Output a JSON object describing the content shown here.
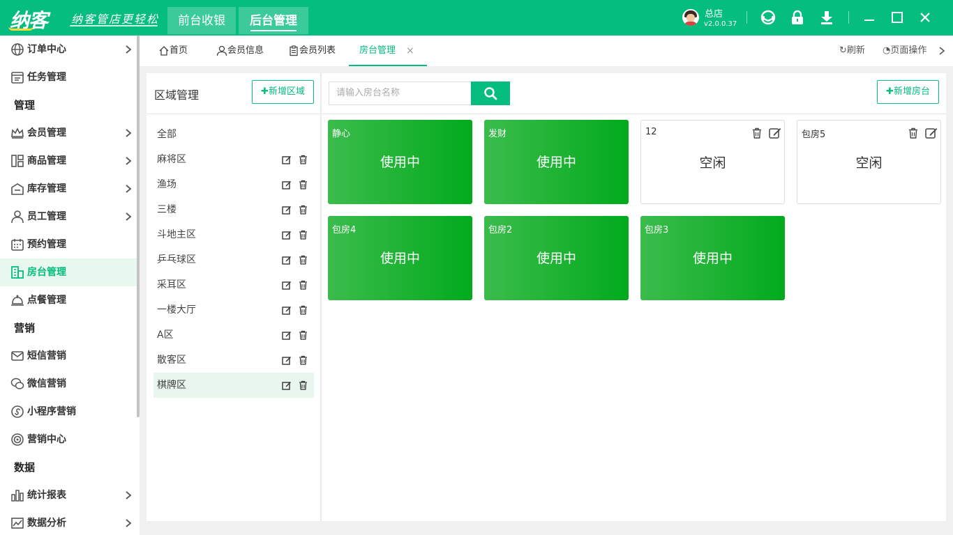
{
  "header": {
    "logo": "纳客",
    "slogan": "纳客管店更轻松",
    "nav": [
      "前台收银",
      "后台管理"
    ],
    "store_name": "总店",
    "version": "v2.0.0.37",
    "icons": [
      "headset-icon",
      "lock-icon",
      "download-icon",
      "minimize-icon",
      "maximize-icon",
      "close-icon"
    ]
  },
  "sidebar": {
    "items": [
      {
        "label": "订单中心",
        "icon": "globe-icon",
        "chevron": true
      },
      {
        "label": "任务管理",
        "icon": "task-icon",
        "chevron": false
      }
    ],
    "groups": [
      "管理",
      "营销",
      "数据"
    ],
    "manage_items": [
      {
        "label": "会员管理",
        "icon": "crown-icon",
        "chevron": true
      },
      {
        "label": "商品管理",
        "icon": "goods-icon",
        "chevron": true
      },
      {
        "label": "库存管理",
        "icon": "inventory-icon",
        "chevron": true
      },
      {
        "label": "员工管理",
        "icon": "staff-icon",
        "chevron": true
      },
      {
        "label": "预约管理",
        "icon": "calendar-icon",
        "chevron": false
      },
      {
        "label": "房台管理",
        "icon": "room-icon",
        "chevron": false,
        "active": true
      },
      {
        "label": "点餐管理",
        "icon": "bell-icon",
        "chevron": false
      }
    ],
    "marketing_items": [
      {
        "label": "短信营销",
        "icon": "mail-icon"
      },
      {
        "label": "微信营销",
        "icon": "wechat-icon"
      },
      {
        "label": "小程序营销",
        "icon": "miniprogram-icon"
      },
      {
        "label": "营销中心",
        "icon": "target-icon"
      }
    ],
    "data_items": [
      {
        "label": "统计报表",
        "icon": "bar-chart-icon",
        "chevron": true
      },
      {
        "label": "数据分析",
        "icon": "trend-icon",
        "chevron": true
      }
    ]
  },
  "tabs": [
    {
      "label": "首页",
      "icon": "home-icon"
    },
    {
      "label": "会员信息",
      "icon": "user-icon"
    },
    {
      "label": "会员列表",
      "icon": "clipboard-icon"
    },
    {
      "label": "房台管理",
      "active": true,
      "closable": true
    }
  ],
  "toolbar": {
    "refresh": "刷新",
    "page_ops": "页面操作"
  },
  "areas": {
    "title": "区域管理",
    "add_button": "新增区域",
    "list": [
      "全部",
      "麻将区",
      "渔场",
      "三楼",
      "斗地主区",
      "乒乓球区",
      "采耳区",
      "一楼大厅",
      "A区",
      "散客区",
      "棋牌区"
    ],
    "selected": "棋牌区"
  },
  "tables": {
    "search_placeholder": "请输入房台名称",
    "add_button": "新增房台",
    "items": [
      {
        "name": "静心",
        "status": "使用中",
        "state": "busy"
      },
      {
        "name": "发财",
        "status": "使用中",
        "state": "busy"
      },
      {
        "name": "12",
        "status": "空闲",
        "state": "free"
      },
      {
        "name": "包房5",
        "status": "空闲",
        "state": "free"
      },
      {
        "name": "包房4",
        "status": "使用中",
        "state": "busy"
      },
      {
        "name": "包房2",
        "status": "使用中",
        "state": "busy"
      },
      {
        "name": "包房3",
        "status": "使用中",
        "state": "busy"
      }
    ]
  },
  "colors": {
    "brand": "#05bd7e",
    "busy": "#02aa1c",
    "active_bg": "#e8f8ef"
  }
}
